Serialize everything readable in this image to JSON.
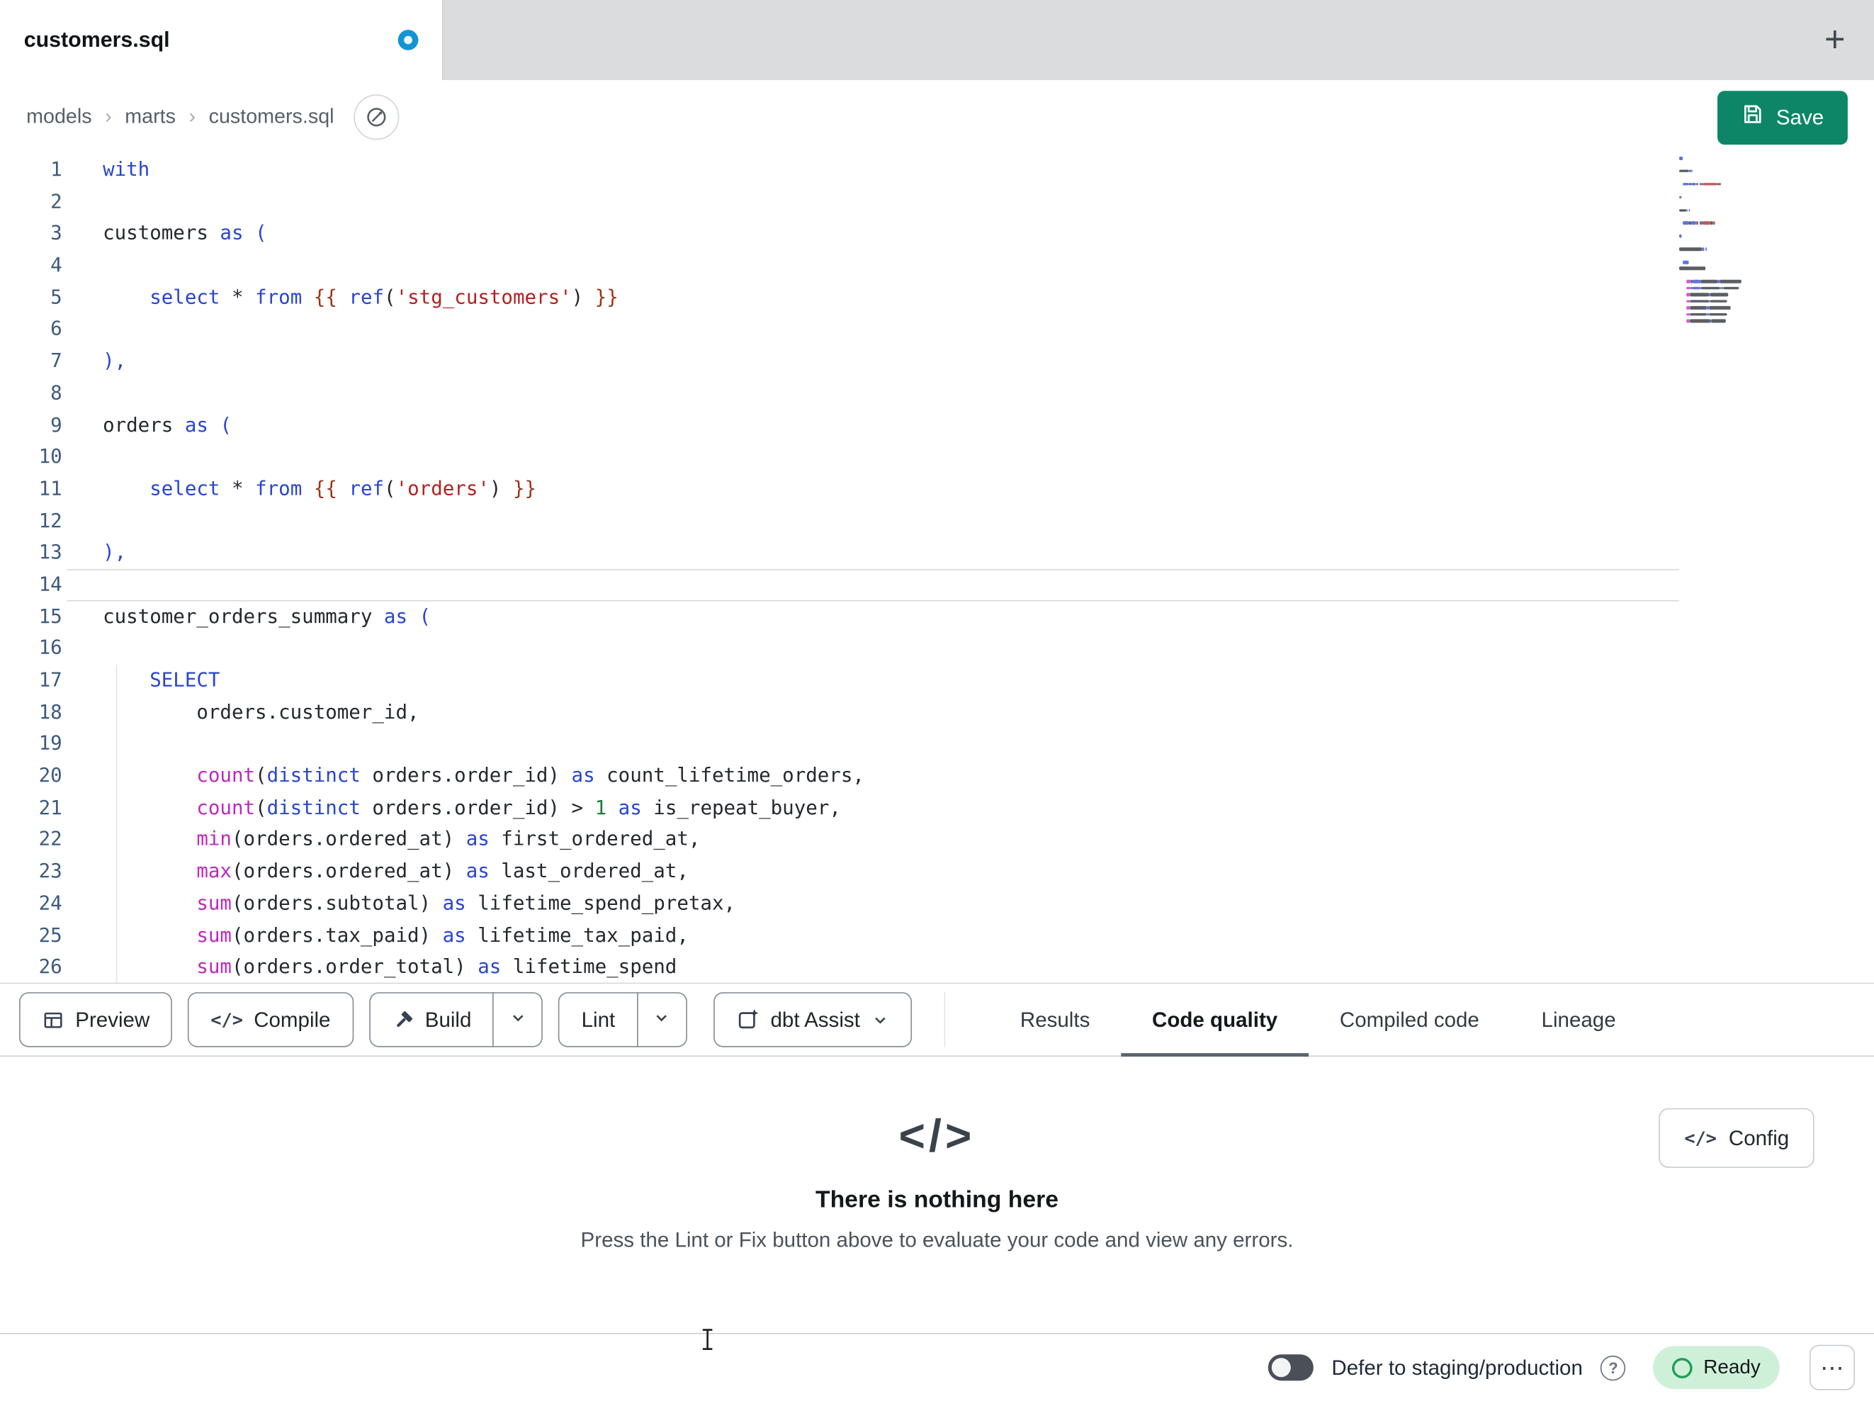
{
  "tab_bar": {
    "active_tab": "customers.sql",
    "new_tab_icon": "+"
  },
  "breadcrumb": {
    "items": [
      "models",
      "marts",
      "customers.sql"
    ],
    "separator": "›"
  },
  "header": {
    "save_label": "Save"
  },
  "icons": {
    "code_glyph": "</>"
  },
  "editor": {
    "active_line": 14,
    "token_colors": {
      "keyword": "#2945d1",
      "default": "#24292f",
      "jinja_brace": "#9a3416",
      "string": "#b22222",
      "function": "#bd2abd",
      "number": "#1a7f37",
      "paren": "#2945d1"
    },
    "lines": [
      {
        "num": 1,
        "tokens": [
          [
            "k",
            "with"
          ]
        ]
      },
      {
        "num": 2,
        "tokens": []
      },
      {
        "num": 3,
        "tokens": [
          [
            "d",
            "customers "
          ],
          [
            "k",
            "as"
          ],
          [
            "d",
            " "
          ],
          [
            "p",
            "("
          ]
        ]
      },
      {
        "num": 4,
        "tokens": []
      },
      {
        "num": 5,
        "tokens": [
          [
            "d",
            "    "
          ],
          [
            "k",
            "select"
          ],
          [
            "d",
            " * "
          ],
          [
            "k",
            "from"
          ],
          [
            "d",
            " "
          ],
          [
            "j",
            "{{"
          ],
          [
            "d",
            " "
          ],
          [
            "k",
            "ref"
          ],
          [
            "d",
            "("
          ],
          [
            "s",
            "'stg_customers'"
          ],
          [
            "d",
            ") "
          ],
          [
            "j",
            "}}"
          ]
        ]
      },
      {
        "num": 6,
        "tokens": []
      },
      {
        "num": 7,
        "tokens": [
          [
            "p",
            "),"
          ]
        ]
      },
      {
        "num": 8,
        "tokens": []
      },
      {
        "num": 9,
        "tokens": [
          [
            "d",
            "orders "
          ],
          [
            "k",
            "as"
          ],
          [
            "d",
            " "
          ],
          [
            "p",
            "("
          ]
        ]
      },
      {
        "num": 10,
        "tokens": []
      },
      {
        "num": 11,
        "tokens": [
          [
            "d",
            "    "
          ],
          [
            "k",
            "select"
          ],
          [
            "d",
            " * "
          ],
          [
            "k",
            "from"
          ],
          [
            "d",
            " "
          ],
          [
            "j",
            "{{"
          ],
          [
            "d",
            " "
          ],
          [
            "k",
            "ref"
          ],
          [
            "d",
            "("
          ],
          [
            "s",
            "'orders'"
          ],
          [
            "d",
            ") "
          ],
          [
            "j",
            "}}"
          ]
        ]
      },
      {
        "num": 12,
        "tokens": []
      },
      {
        "num": 13,
        "tokens": [
          [
            "p",
            "),"
          ]
        ]
      },
      {
        "num": 14,
        "tokens": []
      },
      {
        "num": 15,
        "tokens": [
          [
            "d",
            "customer_orders_summary "
          ],
          [
            "k",
            "as"
          ],
          [
            "d",
            " "
          ],
          [
            "p",
            "("
          ]
        ]
      },
      {
        "num": 16,
        "tokens": []
      },
      {
        "num": 17,
        "tokens": [
          [
            "d",
            "    "
          ],
          [
            "k",
            "SELECT"
          ]
        ]
      },
      {
        "num": 18,
        "tokens": [
          [
            "d",
            "        orders.customer_id,"
          ]
        ]
      },
      {
        "num": 19,
        "tokens": []
      },
      {
        "num": 20,
        "tokens": [
          [
            "d",
            "        "
          ],
          [
            "f",
            "count"
          ],
          [
            "d",
            "("
          ],
          [
            "k",
            "distinct"
          ],
          [
            "d",
            " orders.order_id) "
          ],
          [
            "k",
            "as"
          ],
          [
            "d",
            " count_lifetime_orders,"
          ]
        ]
      },
      {
        "num": 21,
        "tokens": [
          [
            "d",
            "        "
          ],
          [
            "f",
            "count"
          ],
          [
            "d",
            "("
          ],
          [
            "k",
            "distinct"
          ],
          [
            "d",
            " orders.order_id) > "
          ],
          [
            "n",
            "1"
          ],
          [
            "d",
            " "
          ],
          [
            "k",
            "as"
          ],
          [
            "d",
            " is_repeat_buyer,"
          ]
        ]
      },
      {
        "num": 22,
        "tokens": [
          [
            "d",
            "        "
          ],
          [
            "f",
            "min"
          ],
          [
            "d",
            "(orders.ordered_at) "
          ],
          [
            "k",
            "as"
          ],
          [
            "d",
            " first_ordered_at,"
          ]
        ]
      },
      {
        "num": 23,
        "tokens": [
          [
            "d",
            "        "
          ],
          [
            "f",
            "max"
          ],
          [
            "d",
            "(orders.ordered_at) "
          ],
          [
            "k",
            "as"
          ],
          [
            "d",
            " last_ordered_at,"
          ]
        ]
      },
      {
        "num": 24,
        "tokens": [
          [
            "d",
            "        "
          ],
          [
            "f",
            "sum"
          ],
          [
            "d",
            "(orders.subtotal) "
          ],
          [
            "k",
            "as"
          ],
          [
            "d",
            " lifetime_spend_pretax,"
          ]
        ]
      },
      {
        "num": 25,
        "tokens": [
          [
            "d",
            "        "
          ],
          [
            "f",
            "sum"
          ],
          [
            "d",
            "(orders.tax_paid) "
          ],
          [
            "k",
            "as"
          ],
          [
            "d",
            " lifetime_tax_paid,"
          ]
        ]
      },
      {
        "num": 26,
        "tokens": [
          [
            "d",
            "        "
          ],
          [
            "f",
            "sum"
          ],
          [
            "d",
            "(orders.order_total) "
          ],
          [
            "k",
            "as"
          ],
          [
            "d",
            " lifetime_spend"
          ]
        ]
      }
    ]
  },
  "toolbar": {
    "preview_label": "Preview",
    "compile_label": "Compile",
    "build_label": "Build",
    "lint_label": "Lint",
    "assist_label": "dbt Assist"
  },
  "panel_tabs": {
    "items": [
      {
        "label": "Results",
        "active": false
      },
      {
        "label": "Code quality",
        "active": true
      },
      {
        "label": "Compiled code",
        "active": false
      },
      {
        "label": "Lineage",
        "active": false
      }
    ]
  },
  "results_panel": {
    "config_label": "Config",
    "empty_icon": "</>",
    "empty_title": "There is nothing here",
    "empty_subtitle": "Press the Lint or Fix button above to evaluate your code and view any errors."
  },
  "status_bar": {
    "defer_label": "Defer to staging/production",
    "help_icon": "?",
    "ready_label": "Ready",
    "menu_icon": "⋯"
  },
  "colors": {
    "save_accent": "#0c8666",
    "unsaved_dot": "#1494d6",
    "ready_bg": "#cff0d8",
    "ready_ring": "#1d9e55",
    "tabbar_bg": "#dbdcdd"
  }
}
